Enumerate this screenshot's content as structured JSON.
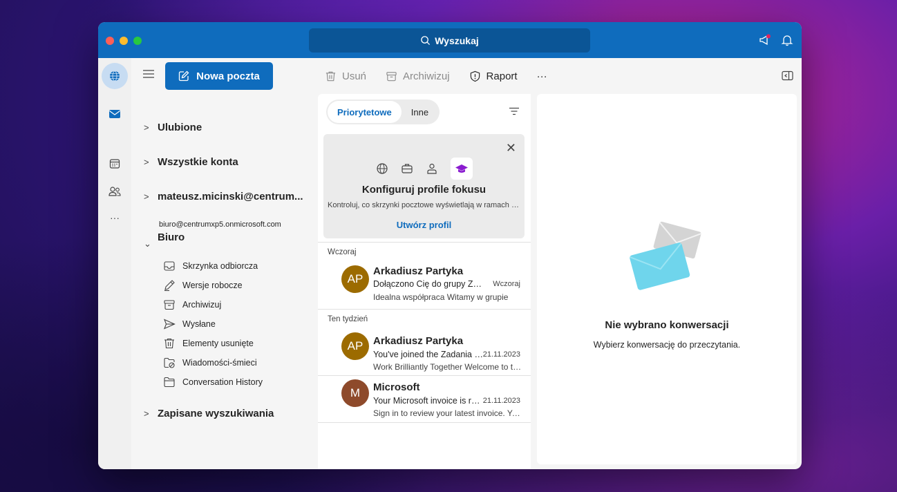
{
  "titlebar": {
    "search_label": "Wyszukaj"
  },
  "nav": {
    "new_mail_label": "Nowa poczta",
    "sections": {
      "favorites": "Ulubione",
      "all_accounts": "Wszystkie konta",
      "account1": "mateusz.micinski@centrum...",
      "office": "Biuro",
      "office_email": "biuro@centrumxp5.onmicrosoft.com",
      "saved_searches": "Zapisane wyszukiwania"
    },
    "folders": [
      {
        "label": "Skrzynka odbiorcza",
        "icon": "inbox-icon"
      },
      {
        "label": "Wersje robocze",
        "icon": "drafts-icon"
      },
      {
        "label": "Archiwizuj",
        "icon": "archive-icon"
      },
      {
        "label": "Wysłane",
        "icon": "sent-icon"
      },
      {
        "label": "Elementy usunięte",
        "icon": "trash-icon"
      },
      {
        "label": "Wiadomości-śmieci",
        "icon": "junk-icon"
      },
      {
        "label": "Conversation History",
        "icon": "folder-icon"
      }
    ]
  },
  "toolbar": {
    "delete_label": "Usuń",
    "archive_label": "Archiwizuj",
    "report_label": "Raport",
    "more_label": "···"
  },
  "list": {
    "tabs": [
      "Priorytetowe",
      "Inne"
    ],
    "focus_card": {
      "title": "Konfiguruj profile fokusu",
      "description": "Kontroluj, co skrzynki pocztowe wyświetlają w ramach profilu",
      "link": "Utwórz profil"
    },
    "groups": [
      "Wczoraj",
      "Ten tydzień"
    ],
    "messages": [
      {
        "initials": "AP",
        "sender": "Arkadiusz Partyka",
        "subject": "Dołączono Cię do grupy Zadania",
        "date": "Wczoraj",
        "preview": "Idealna współpraca Witamy w grupie",
        "avatar_color": "#9c6b00"
      },
      {
        "initials": "AP",
        "sender": "Arkadiusz Partyka",
        "subject": "You've joined the Zadania group",
        "date": "21.11.2023",
        "preview": "Work Brilliantly Together Welcome to the group",
        "avatar_color": "#9c6b00"
      },
      {
        "initials": "M",
        "sender": "Microsoft",
        "subject": "Your Microsoft invoice is ready",
        "date": "21.11.2023",
        "preview": "Sign in to review your latest invoice. Your invoice is ready",
        "avatar_color": "#8e4a2b"
      }
    ]
  },
  "reading": {
    "empty_title": "Nie wybrano konwersacji",
    "empty_subtitle": "Wybierz konwersację do przeczytania."
  },
  "colors": {
    "accent": "#0f6cbd"
  }
}
